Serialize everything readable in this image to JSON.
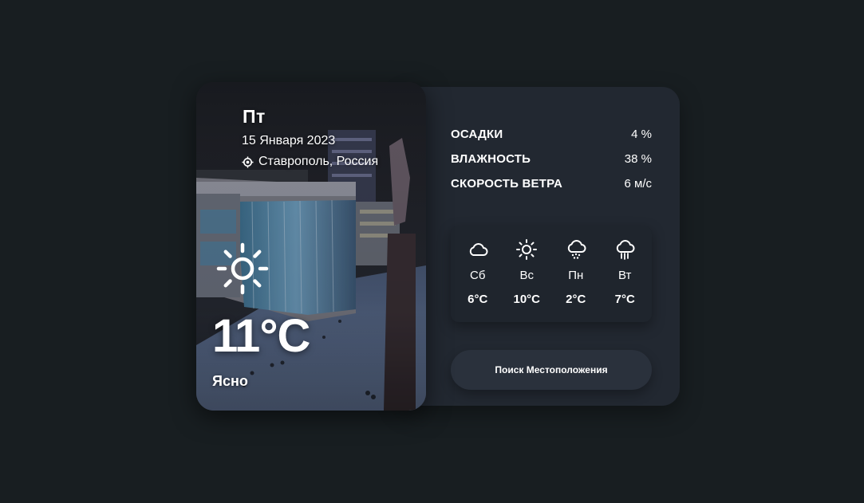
{
  "card": {
    "day": "Пт",
    "date": "15 Января 2023",
    "location": "Ставрополь, Россия",
    "temperature": "11°C",
    "condition": "Ясно",
    "icon": "sun-icon"
  },
  "stats": [
    {
      "label": "ОСАДКИ",
      "value": "4 %"
    },
    {
      "label": "ВЛАЖНОСТЬ",
      "value": "38 %"
    },
    {
      "label": "СКОРОСТЬ ВЕТРА",
      "value": "6 м/с"
    }
  ],
  "forecast": [
    {
      "day": "Сб",
      "temp": "6°C",
      "icon": "cloud-icon"
    },
    {
      "day": "Вс",
      "temp": "10°C",
      "icon": "sun-icon"
    },
    {
      "day": "Пн",
      "temp": "2°C",
      "icon": "snow-cloud-icon"
    },
    {
      "day": "Вт",
      "temp": "7°C",
      "icon": "rain-cloud-icon"
    }
  ],
  "search_button": "Поиск Местоположения",
  "colors": {
    "background": "#181e21",
    "panel": "#222831",
    "forecast_box": "#1f252d",
    "button": "#2a313c",
    "text": "#ffffff"
  }
}
